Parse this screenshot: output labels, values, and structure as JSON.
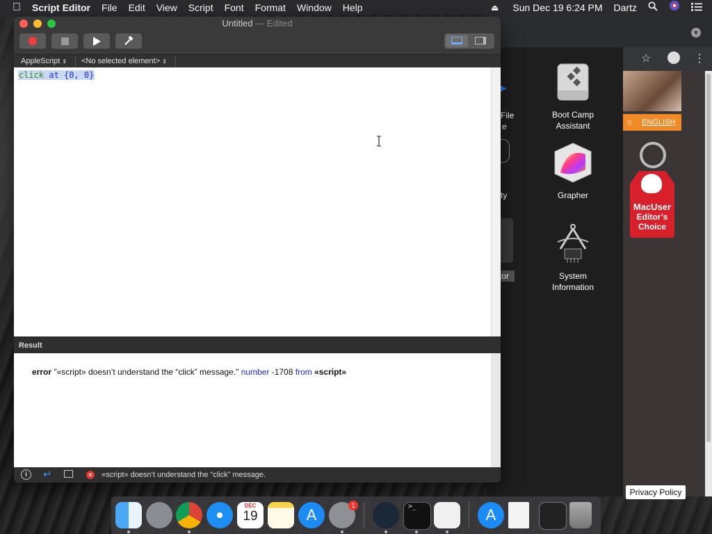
{
  "menubar": {
    "app_name": "Script Editor",
    "menus": [
      "File",
      "Edit",
      "View",
      "Script",
      "Font",
      "Format",
      "Window",
      "Help"
    ],
    "datetime": "Sun Dec 19  6:24 PM",
    "user": "Dartz"
  },
  "window": {
    "title": "Untitled",
    "title_suffix": "— Edited",
    "language": "AppleScript",
    "element": "<No selected element>",
    "code": {
      "keyword1": "click",
      "keyword2": "at",
      "rest": " {0, 0}"
    },
    "result_header": "Result",
    "result": {
      "p1": "error",
      "p2": " \"«script» doesn’t understand the “click” message.\" ",
      "p3": "number",
      "p4": " -1708 ",
      "p5": "from",
      "p6": " «script»"
    },
    "status_message": "«script» doesn’t understand the “click” message."
  },
  "apps": {
    "partial_1": "File",
    "partial_2": "e",
    "partial_3": "ty",
    "partial_4": "tor",
    "boot_camp": "Boot Camp Assistant",
    "grapher": "Grapher",
    "system_info": "System Information"
  },
  "browser": {
    "language_link": "ENGLISH",
    "badge_line1": "MacUser",
    "badge_line2": "Editor’s",
    "badge_line3": "Choice",
    "privacy": "Privacy Policy"
  },
  "dock": {
    "calendar_month": "DEC",
    "calendar_day": "19",
    "badge_count": "1"
  },
  "colors": {
    "keyword": "#3b8a1c",
    "syntax_blue": "#1e2bd8",
    "selection": "#c7d9f3",
    "close": "#fe5f57",
    "minimize": "#febc2e",
    "zoom": "#28c840"
  }
}
